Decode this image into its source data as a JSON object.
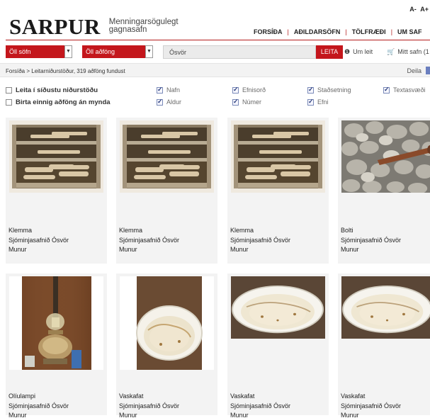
{
  "header": {
    "font_small": "A-",
    "font_large": "A+",
    "logo_main": "SARPUR",
    "logo_sub": "Menningarsögulegt gagnasafn",
    "nav": [
      "FORSÍÐA",
      "AÐILDARSÖFN",
      "TÖLFRÆÐI",
      "UM SAF"
    ]
  },
  "search": {
    "collection_select": "Öll söfn",
    "type_select": "Öll aðföng",
    "query": "Ósvör",
    "button": "LEITA",
    "about_link": "Um leit",
    "my_collection": "Mitt safn (1"
  },
  "breadcrumb": "Forsíða > Leitarniðurstöður, 319 aðföng fundust",
  "share": "Deila",
  "filters": {
    "search_in_results": "Leita í síðustu niðurstöðu",
    "show_without_images": "Birta einnig aðföng án mynda",
    "fields": [
      {
        "label": "Nafn",
        "checked": true
      },
      {
        "label": "Efnisorð",
        "checked": true
      },
      {
        "label": "Staðsetning",
        "checked": true
      },
      {
        "label": "Textasvæði",
        "checked": true
      },
      {
        "label": "Aldur",
        "checked": true
      },
      {
        "label": "Númer",
        "checked": true
      },
      {
        "label": "Efni",
        "checked": true
      }
    ]
  },
  "results": [
    {
      "name": "Klemma",
      "museum": "Sjóminjasafnið Ósvör",
      "type": "Munur",
      "image": "wooden-crate-with-clamps"
    },
    {
      "name": "Klemma",
      "museum": "Sjóminjasafnið Ósvör",
      "type": "Munur",
      "image": "wooden-crate-with-clamps"
    },
    {
      "name": "Klemma",
      "museum": "Sjóminjasafnið Ósvör",
      "type": "Munur",
      "image": "wooden-crate-with-clamps"
    },
    {
      "name": "Bolti",
      "museum": "Sjóminjasafnið Ósvör",
      "type": "Munur",
      "image": "rusty-bolt-on-stones"
    },
    {
      "name": "Olíulampi",
      "museum": "Sjóminjasafnið Ósvör",
      "type": "Munur",
      "image": "oil-lamp"
    },
    {
      "name": "Vaskafat",
      "museum": "Sjóminjasafnið Ósvör",
      "type": "Munur",
      "image": "white-enamel-basin"
    },
    {
      "name": "Vaskafat",
      "museum": "Sjóminjasafnið Ósvör",
      "type": "Munur",
      "image": "white-enamel-basin"
    },
    {
      "name": "Vaskafat",
      "museum": "Sjóminjasafnið Ósvör",
      "type": "Munur",
      "image": "white-enamel-basin"
    }
  ],
  "colors": {
    "accent_red": "#c4161c",
    "card_bg": "#f3f3f3"
  }
}
